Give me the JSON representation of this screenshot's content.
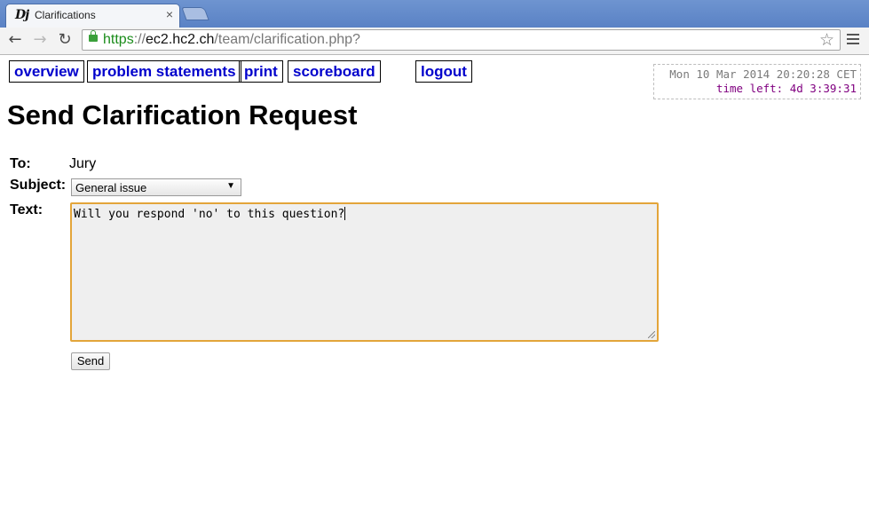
{
  "browser": {
    "tab_favicon": "Dj",
    "tab_title": "Clarifications",
    "tab_close": "×",
    "url_scheme": "https",
    "url_separator": "://",
    "url_host": "ec2.hc2.ch",
    "url_path": "/team/clarification.php?",
    "back_icon": "←",
    "forward_icon": "→",
    "reload_icon": "↻",
    "star_icon": "☆"
  },
  "nav": {
    "overview": "overview",
    "problem_statements": "problem statements",
    "print": "print",
    "scoreboard": "scoreboard",
    "logout": "logout"
  },
  "clock": {
    "datetime": "Mon 10 Mar 2014 20:20:28 CET",
    "time_left": "time left: 4d 3:39:31"
  },
  "page_title": "Send Clarification Request",
  "form": {
    "to_label": "To:",
    "to_value": "Jury",
    "subject_label": "Subject:",
    "subject_value": "General issue",
    "text_label": "Text:",
    "text_value": "Will you respond 'no' to this question?",
    "send_label": "Send"
  },
  "colors": {
    "link": "#0000cc",
    "time_left": "#800080",
    "textarea_focus": "#e3a53a",
    "url_scheme": "#1a8c1a"
  }
}
